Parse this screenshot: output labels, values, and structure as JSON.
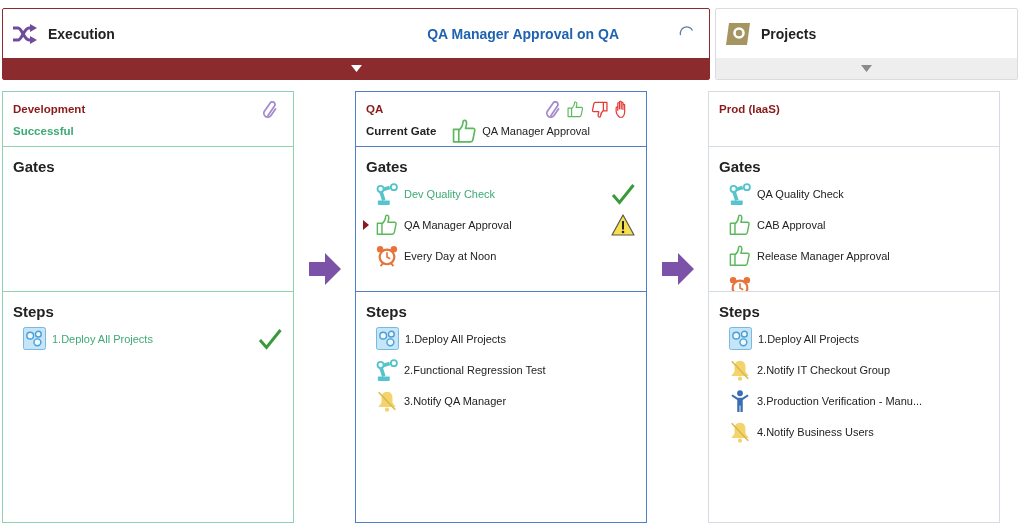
{
  "tabs": [
    {
      "kind": "execution",
      "label": "Execution",
      "status": "QA Manager Approval on QA",
      "busy": true,
      "selected": true
    },
    {
      "kind": "projects",
      "label": "Projects",
      "busy": false,
      "selected": false
    }
  ],
  "stages": [
    {
      "name": "Development",
      "kind": "done",
      "status": "Successful",
      "actions": [
        {
          "kind": "attach"
        }
      ],
      "gates_title": "Gates",
      "steps_title": "Steps",
      "steps": [
        {
          "kind": "deploy",
          "label": "1.Deploy All Projects",
          "done": true
        }
      ]
    },
    {
      "name": "QA",
      "kind": "current",
      "actions": [
        {
          "kind": "attach"
        },
        {
          "kind": "approve"
        },
        {
          "kind": "reject"
        },
        {
          "kind": "hold"
        }
      ],
      "current_gate": {
        "label": "Current Gate",
        "kind": "approval",
        "name": "QA Manager Approval"
      },
      "gates_title": "Gates",
      "gates": [
        {
          "kind": "check",
          "label": "Dev Quality Check",
          "done": true,
          "current": false,
          "warning": false
        },
        {
          "kind": "approval",
          "label": "QA Manager Approval",
          "done": false,
          "current": true,
          "warning": true
        },
        {
          "kind": "schedule",
          "label": "Every Day at Noon",
          "done": false,
          "current": false,
          "warning": false
        }
      ],
      "steps_title": "Steps",
      "steps": [
        {
          "kind": "deploy",
          "label": "1.Deploy All Projects",
          "done": false
        },
        {
          "kind": "test",
          "label": "2.Functional Regression Test",
          "done": false
        },
        {
          "kind": "notify",
          "label": "3.Notify QA Manager",
          "done": false
        }
      ]
    },
    {
      "name": "Prod (IaaS)",
      "kind": "pending",
      "gates_title": "Gates",
      "gates": [
        {
          "kind": "check",
          "label": "QA Quality Check",
          "done": false,
          "current": false,
          "warning": false
        },
        {
          "kind": "approval",
          "label": "CAB Approval",
          "done": false,
          "current": false,
          "warning": false
        },
        {
          "kind": "approval",
          "label": "Release Manager Approval",
          "done": false,
          "current": false,
          "warning": false
        },
        {
          "kind": "schedule"
        }
      ],
      "steps_title": "Steps",
      "steps": [
        {
          "kind": "deploy",
          "label": "1.Deploy All Projects",
          "done": false
        },
        {
          "kind": "notify",
          "label": "2.Notify IT Checkout Group",
          "done": false
        },
        {
          "kind": "manual",
          "label": "3.Production Verification - Manu...",
          "done": false
        },
        {
          "kind": "notify",
          "label": "4.Notify Business Users",
          "done": false
        }
      ]
    }
  ]
}
